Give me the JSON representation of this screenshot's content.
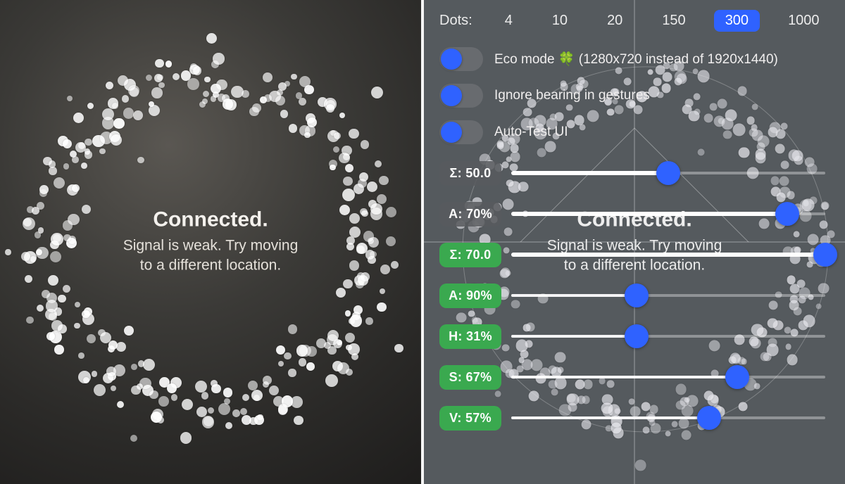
{
  "status": {
    "title": "Connected.",
    "sub": "Signal is weak. Try moving\nto a different location."
  },
  "debug": {
    "dots_label": "Dots:",
    "dot_options": [
      "4",
      "10",
      "20",
      "150",
      "300",
      "1000"
    ],
    "dot_selected_index": 4,
    "toggles": [
      {
        "label": "Eco mode 🍀 (1280x720 instead of 1920x1440)",
        "on": false
      },
      {
        "label": "Ignore bearing in gestures",
        "on": false
      },
      {
        "label": "Auto-Test UI",
        "on": false
      }
    ],
    "sliders": [
      {
        "label": "Σ: 50.0",
        "color": "gray",
        "pct": 50
      },
      {
        "label": "A: 70%",
        "color": "gray",
        "pct": 88
      },
      {
        "label": "Σ: 70.0",
        "color": "green",
        "pct": 100
      },
      {
        "label": "A: 90%",
        "color": "green",
        "pct": 40
      },
      {
        "label": "H: 31%",
        "color": "green",
        "pct": 40
      },
      {
        "label": "S: 67%",
        "color": "green",
        "pct": 72
      },
      {
        "label": "V: 57%",
        "color": "green",
        "pct": 63
      }
    ]
  },
  "colors": {
    "accent_blue": "#2f62ff",
    "badge_green": "#3aa94f"
  }
}
